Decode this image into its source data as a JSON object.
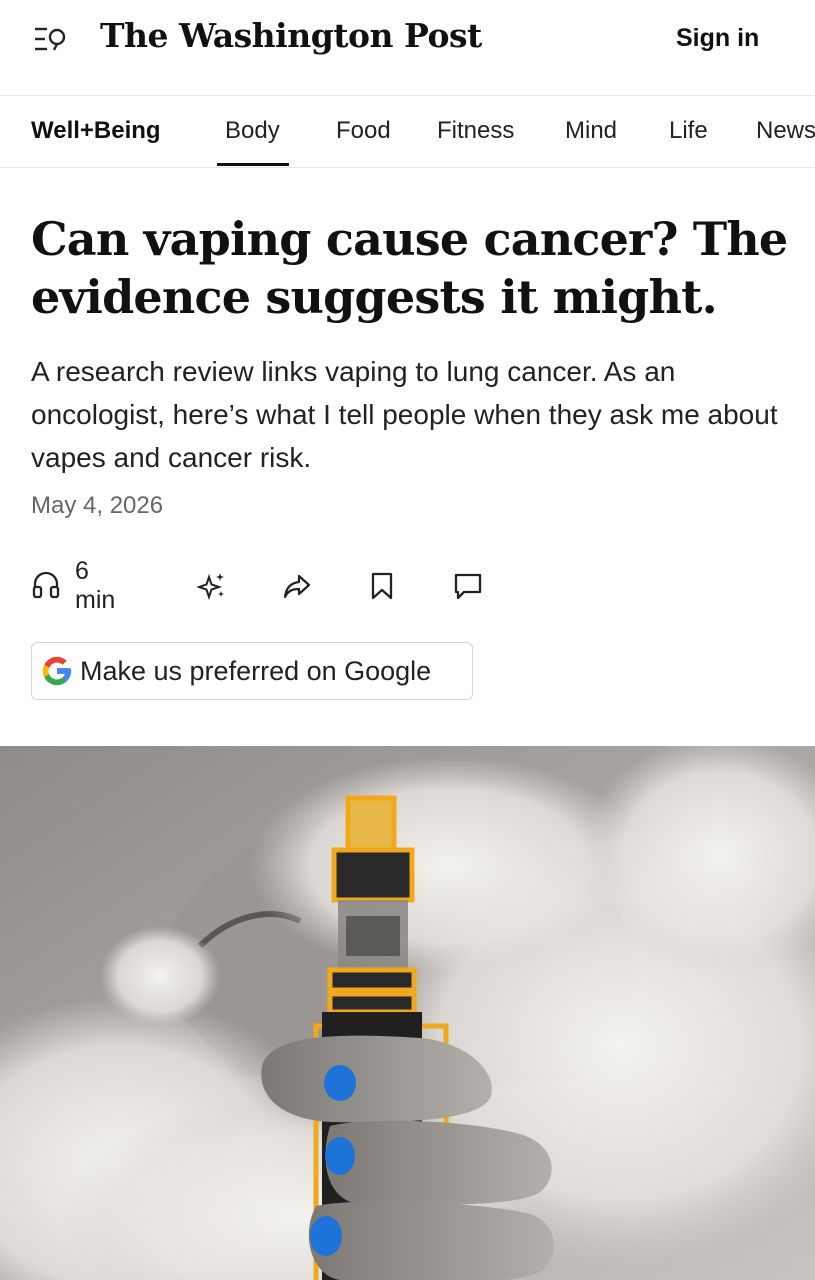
{
  "header": {
    "logo_text": "The Washington Post",
    "sign_in_label": "Sign in",
    "menu_icon": "menu-search-icon"
  },
  "nav": {
    "brand": "Well+Being",
    "items": [
      "Body",
      "Food",
      "Fitness",
      "Mind",
      "Life",
      "News"
    ],
    "active": "Body"
  },
  "article": {
    "headline": "Can vaping cause cancer? The evidence suggests it might.",
    "dek": "A research review links vaping to lung cancer. As an oncologist, here’s what I tell people when they ask me about vapes and cancer risk.",
    "date": "May 4, 2026"
  },
  "actions": {
    "listen_label": "6 min",
    "icons": [
      "headphones-icon",
      "sparkle-icon",
      "share-icon",
      "bookmark-icon",
      "comment-icon"
    ]
  },
  "google_button": {
    "label": "Make us preferred on Google",
    "icon": "google-g-icon"
  },
  "colors": {
    "text": "#111111",
    "muted": "#666666",
    "divider": "#e6e6e6",
    "google_blue": "#4285F4",
    "google_red": "#EA4335",
    "google_yellow": "#FBBC05",
    "google_green": "#34A853",
    "vape_outline": "#F2A81D",
    "nail_blue": "#1E73D8"
  }
}
